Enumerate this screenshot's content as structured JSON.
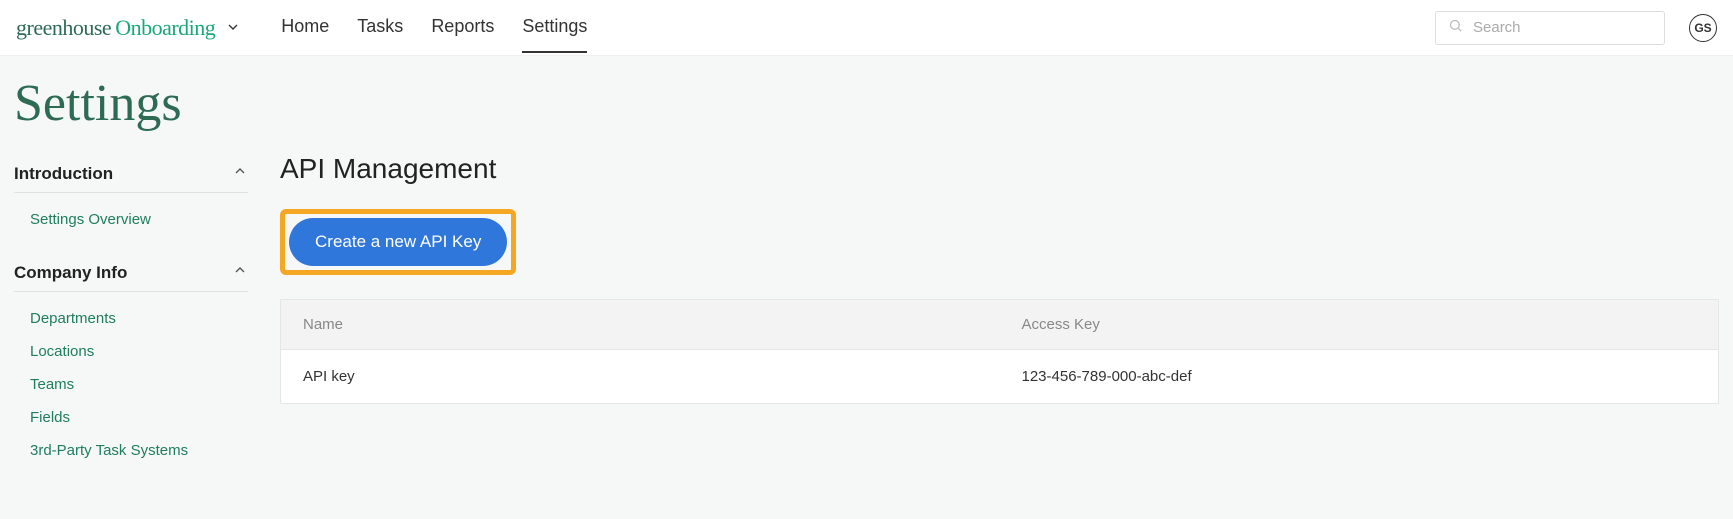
{
  "logo": {
    "part1": "greenhouse",
    "part2": "Onboarding"
  },
  "nav": {
    "items": [
      {
        "label": "Home"
      },
      {
        "label": "Tasks"
      },
      {
        "label": "Reports"
      },
      {
        "label": "Settings"
      }
    ]
  },
  "search": {
    "placeholder": "Search"
  },
  "user": {
    "initials": "GS"
  },
  "page_title": "Settings",
  "sidebar": {
    "sections": [
      {
        "title": "Introduction",
        "items": [
          {
            "label": "Settings Overview"
          }
        ]
      },
      {
        "title": "Company Info",
        "items": [
          {
            "label": "Departments"
          },
          {
            "label": "Locations"
          },
          {
            "label": "Teams"
          },
          {
            "label": "Fields"
          },
          {
            "label": "3rd-Party Task Systems"
          }
        ]
      }
    ]
  },
  "main": {
    "heading": "API Management",
    "create_button": "Create a new API Key",
    "table": {
      "columns": {
        "name": "Name",
        "key": "Access Key"
      },
      "rows": [
        {
          "name": "API key",
          "key": "123-456-789-000-abc-def"
        }
      ]
    }
  }
}
